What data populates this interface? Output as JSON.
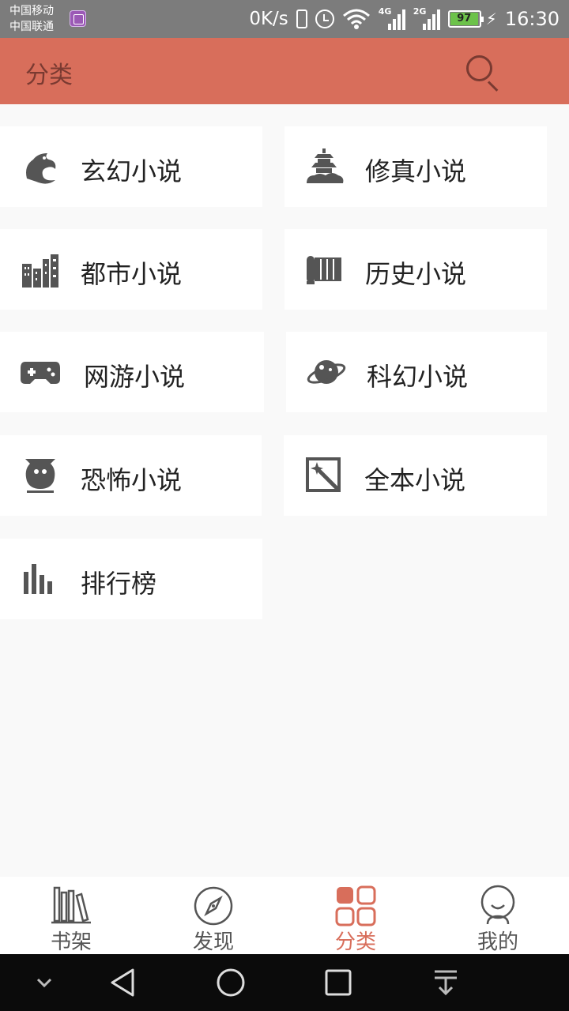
{
  "status_bar": {
    "carrier_1": "中国移动",
    "carrier_2": "中国联通",
    "net_speed": "0K/s",
    "signal_1_type": "4G",
    "signal_2_type": "2G",
    "battery": "97",
    "time": "16:30"
  },
  "app_bar": {
    "title": "分类",
    "accent_color": "#d86e5b"
  },
  "categories": [
    {
      "label": "玄幻小说",
      "icon": "dragon-icon"
    },
    {
      "label": "修真小说",
      "icon": "pagoda-icon"
    },
    {
      "label": "都市小说",
      "icon": "city-icon"
    },
    {
      "label": "历史小说",
      "icon": "scroll-icon"
    },
    {
      "label": "网游小说",
      "icon": "gamepad-icon"
    },
    {
      "label": "科幻小说",
      "icon": "planet-icon"
    },
    {
      "label": "恐怖小说",
      "icon": "ghost-vase-icon"
    },
    {
      "label": "全本小说",
      "icon": "magic-wand-icon"
    },
    {
      "label": "排行榜",
      "icon": "bar-chart-icon"
    }
  ],
  "bottom_nav": [
    {
      "label": "书架",
      "icon": "bookshelf-icon",
      "active": false
    },
    {
      "label": "发现",
      "icon": "compass-icon",
      "active": false
    },
    {
      "label": "分类",
      "icon": "grid-icon",
      "active": true
    },
    {
      "label": "我的",
      "icon": "profile-icon",
      "active": false
    }
  ]
}
